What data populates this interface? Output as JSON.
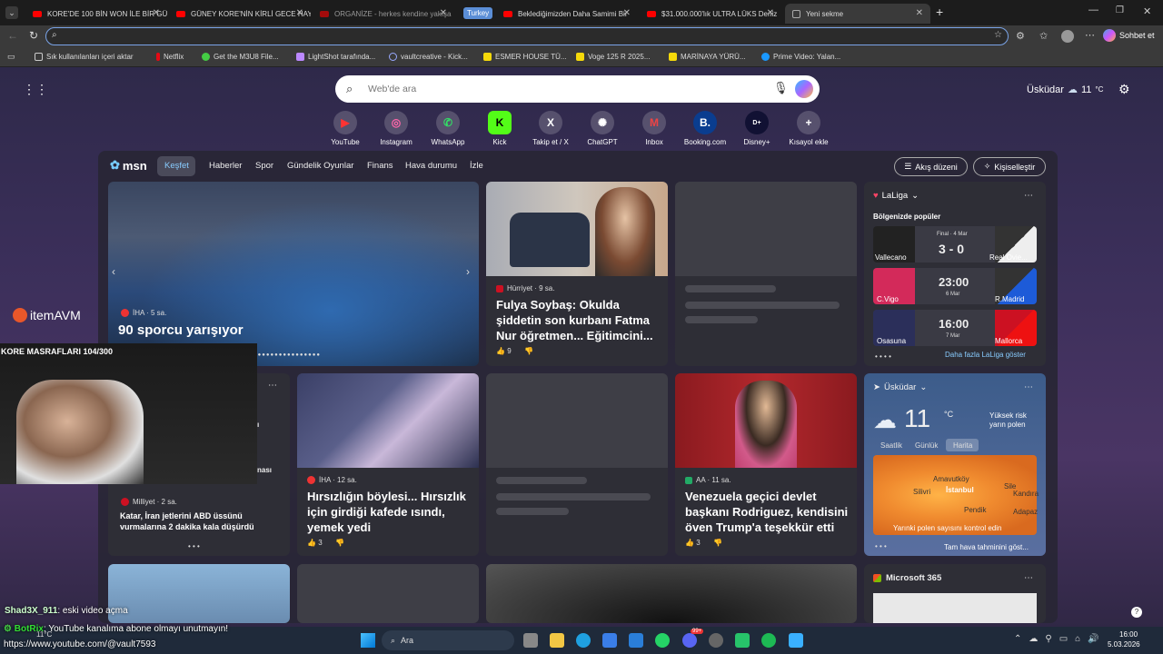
{
  "tabs": [
    {
      "label": "KORE'DE 100 BİN WON İLE BİR GÜ"
    },
    {
      "label": "GÜNEY KORE'NİN KİRLİ GECE HAYA"
    },
    {
      "label": "ORGANİZE - herkes kendine yakışa"
    },
    {
      "group": "Turkey",
      "label": "Beklediğimizden Daha Samimi Bir"
    },
    {
      "label": "$31.000.000'lık ULTRA LÜKS Deniz"
    },
    {
      "label": "Yeni sekme"
    }
  ],
  "address": {
    "placeholder": "",
    "signin": "Sohbet et"
  },
  "bookmarks": [
    "Sık kullanılanları içeri aktar",
    "Netflix",
    "Get the M3U8 File...",
    "LightShot tarafında...",
    "vaultcreative - Kick...",
    "ESMER HOUSE TÜ...",
    "Voge 125 R 2025...",
    "MARİNAYA YÜRÜ...",
    "Prime Video: Yalan..."
  ],
  "search": {
    "placeholder": "Web'de ara"
  },
  "weather_top": {
    "city": "Üsküdar",
    "temp": "11",
    "unit": "°C"
  },
  "shortcuts": [
    "YouTube",
    "Instagram",
    "WhatsApp",
    "Kick",
    "Takip et / X",
    "ChatGPT",
    "Inbox",
    "Booking.com",
    "Disney+",
    "Kısayol ekle"
  ],
  "nav": {
    "logo": "msn",
    "items": [
      "Keşfet",
      "Haberler",
      "Spor",
      "Gündelik Oyunlar",
      "Finans",
      "Hava durumu",
      "İzle"
    ],
    "layout": "Akış düzeni",
    "personalize": "Kişiselleştir"
  },
  "hero": {
    "source": "İHA · 5 sa.",
    "title": "90 sporcu yarışıyor"
  },
  "card1": {
    "source": "Hürriyet · 9 sa.",
    "title": "Fulya Soybaş: Okulda şiddetin son kurbanı Fatma Nur öğretmen... Eğitimcini...",
    "likes": "9"
  },
  "laliga": {
    "title": "LaLiga",
    "sub": "Bölgenizde popüler",
    "more": "Daha fazla LaLiga göster",
    "matches": [
      {
        "home": "Vallecano",
        "away": "Real Ovie...",
        "status": "Final · 4 Mar",
        "score": "3 - 0"
      },
      {
        "home": "C.Vigo",
        "away": "R.Madrid",
        "status": "6 Mar",
        "score": "23:00"
      },
      {
        "home": "Osasuna",
        "away": "Mallorca",
        "status": "7 Mar",
        "score": "16:00"
      }
    ]
  },
  "card_mil": {
    "source": "Milliyet · 2 sa.",
    "title": "Katar, İran jetlerini ABD üssünü vurmalarına 2 dakika kala düşürdü",
    "frag1": "ı",
    "frag2": "nası"
  },
  "card_iha": {
    "source": "İHA · 12 sa.",
    "title": "Hırsızlığın böylesi... Hırsızlık için girdiği kafede ısındı, yemek yedi",
    "likes": "3"
  },
  "card_aa": {
    "source": "AA · 11 sa.",
    "title": "Venezuela geçici devlet başkanı Rodriguez, kendisini öven Trump'a teşekkür etti",
    "likes": "3"
  },
  "weather": {
    "city": "Üsküdar",
    "temp": "11",
    "unit": "°C",
    "risk": "Yüksek risk",
    "risk2": "yarın polen",
    "tabs": [
      "Saatlik",
      "Günlük",
      "Harita"
    ],
    "places": [
      "Amavutköy",
      "Silivri",
      "İstanbul",
      "Sile",
      "Kandıra",
      "Pendik",
      "Adapaz"
    ],
    "pollen": "Yarınki polen sayısını kontrol edin",
    "more": "Tam hava tahminini göst..."
  },
  "m365": {
    "title": "Microsoft 365"
  },
  "overlay": {
    "brand": "itemAVM",
    "counter": "KORE MASRAFLARI 104/300",
    "chat1_user": "Shad3X_911",
    "chat1_msg": ": eski video açma",
    "chat2_user": "BotRix",
    "chat2_msg": ": YouTube kanalıma abone olmayı unutmayın!",
    "chat3": "https://www.youtube.com/@vault7593",
    "small_temp": "11°C"
  },
  "taskbar": {
    "search": "Ara",
    "time": "16:00",
    "date": "5.03.2026",
    "notif": "99+"
  }
}
